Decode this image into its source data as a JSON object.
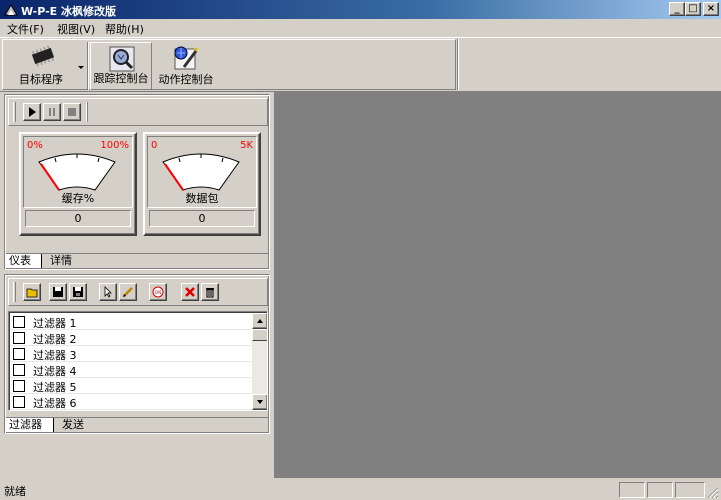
{
  "window": {
    "title": "W-P-E 冰枫修改版",
    "minimize": "_",
    "maximize": "□",
    "close": "×"
  },
  "menu": [
    "文件(F)",
    "视图(V)",
    "帮助(H)"
  ],
  "toolbar": {
    "target_label": "目标程序",
    "trace_label": "跟踪控制台",
    "action_label": "动作控制台"
  },
  "gauges": [
    {
      "name": "缓存%",
      "min": "0%",
      "max": "100%",
      "value": "0"
    },
    {
      "name": "数据包",
      "min": "0",
      "max": "5K",
      "value": "0"
    }
  ],
  "upper_tabs": [
    "仪表",
    "详情"
  ],
  "filters": [
    {
      "label": "过滤器 1"
    },
    {
      "label": "过滤器 2"
    },
    {
      "label": "过滤器 3"
    },
    {
      "label": "过滤器 4"
    },
    {
      "label": "过滤器 5"
    },
    {
      "label": "过滤器 6"
    }
  ],
  "lower_tabs": [
    "过滤器",
    "发送"
  ],
  "status": {
    "text": "就绪"
  },
  "colors": {
    "accent_red": "#ff0000",
    "title_blue": "#0a246a",
    "workspace": "#808080"
  }
}
